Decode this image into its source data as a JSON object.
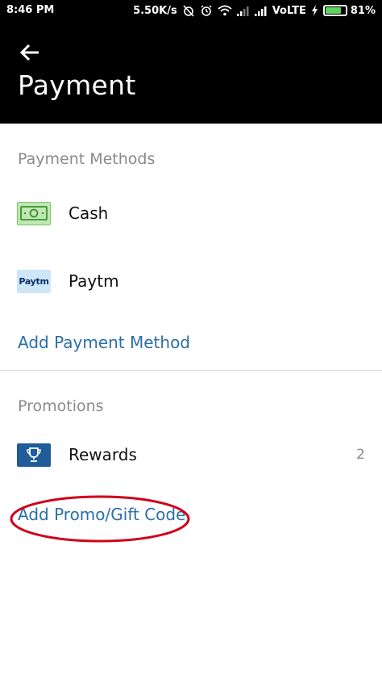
{
  "status_bar": {
    "time": "8:46 PM",
    "network_speed": "5.50K/s",
    "network_type": "VoLTE",
    "battery_percent": "81%",
    "battery_level": 0.81,
    "icons": [
      "alarm-off-icon",
      "alarm-icon",
      "wifi-icon",
      "signal-icon",
      "signal-icon",
      "charging-icon",
      "battery-icon"
    ]
  },
  "header": {
    "title": "Payment",
    "back_icon": "arrow-left-icon"
  },
  "payment_methods": {
    "section_label": "Payment Methods",
    "items": [
      {
        "label": "Cash",
        "icon": "cash-icon"
      },
      {
        "label": "Paytm",
        "icon": "paytm-logo",
        "logo_text": "Paytm"
      }
    ],
    "add_link": "Add Payment Method"
  },
  "promotions": {
    "section_label": "Promotions",
    "items": [
      {
        "label": "Rewards",
        "icon": "trophy-icon",
        "count": "2"
      }
    ],
    "add_link": "Add Promo/Gift Code"
  },
  "colors": {
    "header_bg": "#000000",
    "link": "#2a6fa8",
    "section_label": "#8a8a8f",
    "annotation": "#d0021b",
    "cash_green": "#6fbf5a",
    "reward_blue": "#1f5c99"
  }
}
